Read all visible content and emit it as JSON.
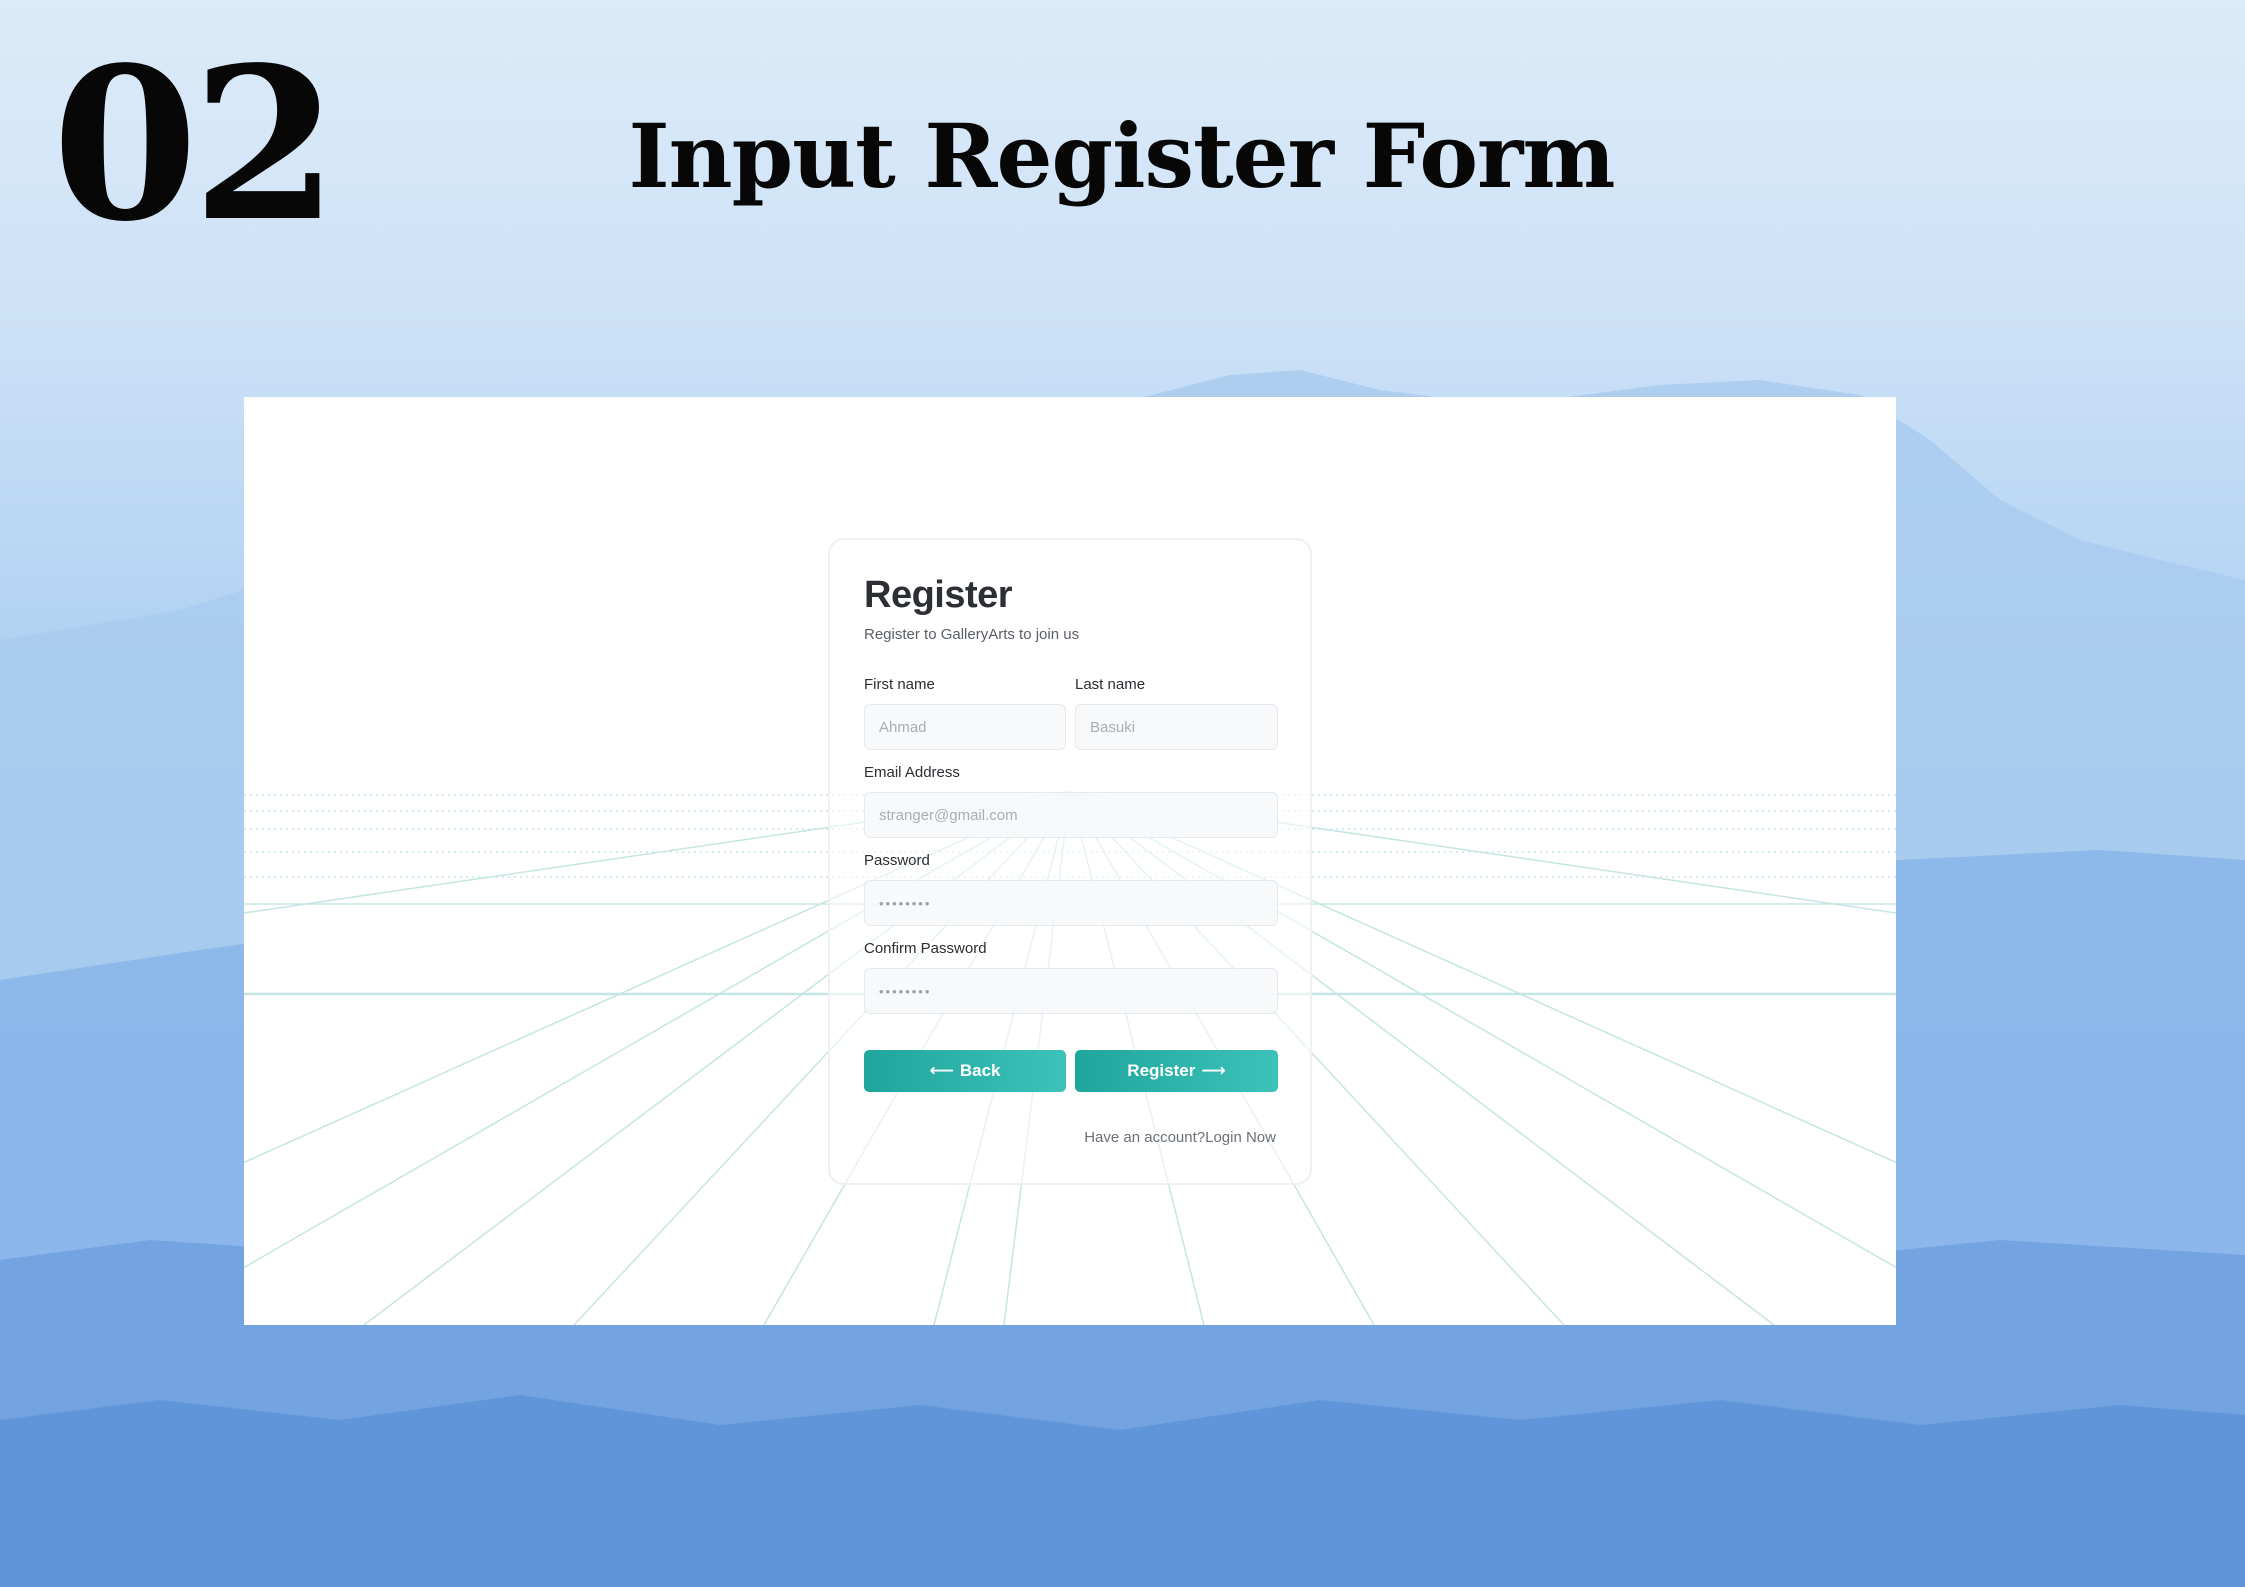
{
  "slide": {
    "number": "02",
    "title": "Input Register Form"
  },
  "form": {
    "title": "Register",
    "subtitle": "Register to GalleryArts to join us",
    "first_name": {
      "label": "First name",
      "placeholder": "Ahmad"
    },
    "last_name": {
      "label": "Last name",
      "placeholder": "Basuki"
    },
    "email": {
      "label": "Email Address",
      "placeholder": "stranger@gmail.com"
    },
    "password": {
      "label": "Password",
      "value": "••••••••"
    },
    "confirm_password": {
      "label": "Confirm Password",
      "value": "••••••••"
    },
    "back_button": {
      "arrow": "⟵",
      "label": "Back"
    },
    "register_button": {
      "label": "Register",
      "arrow": "⟶"
    },
    "footer": {
      "text": "Have an account?",
      "link": "Login Now"
    }
  },
  "colors": {
    "accent": "#2bb3aa",
    "background_sky": "#9fc6ef",
    "title_text": "#070707"
  }
}
